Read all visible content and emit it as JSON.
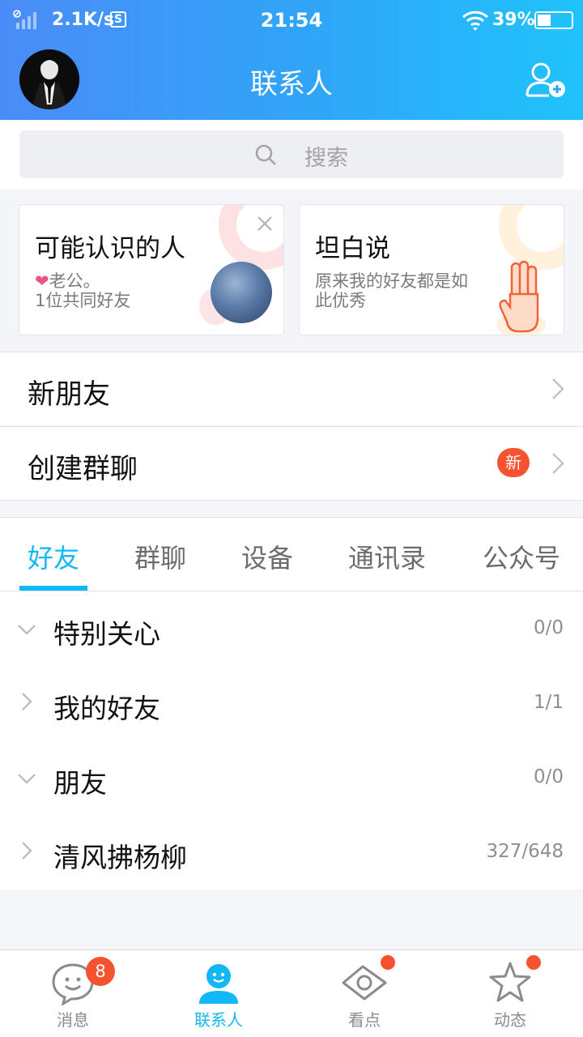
{
  "colors": {
    "accent": "#12b7f5",
    "badge": "#f5532f",
    "header_start": "#4a8cf7",
    "header_end": "#1fc3fb"
  },
  "status_bar": {
    "net_speed": "2.1K/s",
    "s_icon": "S",
    "time": "21:54",
    "battery": "39%",
    "battery_level": 0.39
  },
  "header": {
    "title": "联系人"
  },
  "search": {
    "placeholder": "搜索"
  },
  "cards": [
    {
      "title": "可能认识的人",
      "line1": "❤老公。",
      "line2": "1位共同好友"
    },
    {
      "title": "坦白说",
      "line1": "原来我的好友都是如",
      "line2": "此优秀"
    }
  ],
  "rows": [
    {
      "label": "新朋友"
    },
    {
      "label": "创建群聊",
      "badge": "新"
    }
  ],
  "tabs": [
    "好友",
    "群聊",
    "设备",
    "通讯录",
    "公众号"
  ],
  "active_tab": "好友",
  "groups": [
    {
      "name": "特别关心",
      "count": "0/0",
      "expanded": true
    },
    {
      "name": "我的好友",
      "count": "1/1",
      "expanded": false
    },
    {
      "name": "朋友",
      "count": "0/0",
      "expanded": true
    },
    {
      "name": "清风拂杨柳",
      "count": "327/648",
      "expanded": false
    }
  ],
  "tabbar": [
    {
      "label": "消息",
      "icon": "chat-bubble-icon",
      "badge": "8"
    },
    {
      "label": "联系人",
      "icon": "contact-person-icon",
      "active": true
    },
    {
      "label": "看点",
      "icon": "eye-icon",
      "dot": true
    },
    {
      "label": "动态",
      "icon": "star-icon",
      "dot": true
    }
  ]
}
